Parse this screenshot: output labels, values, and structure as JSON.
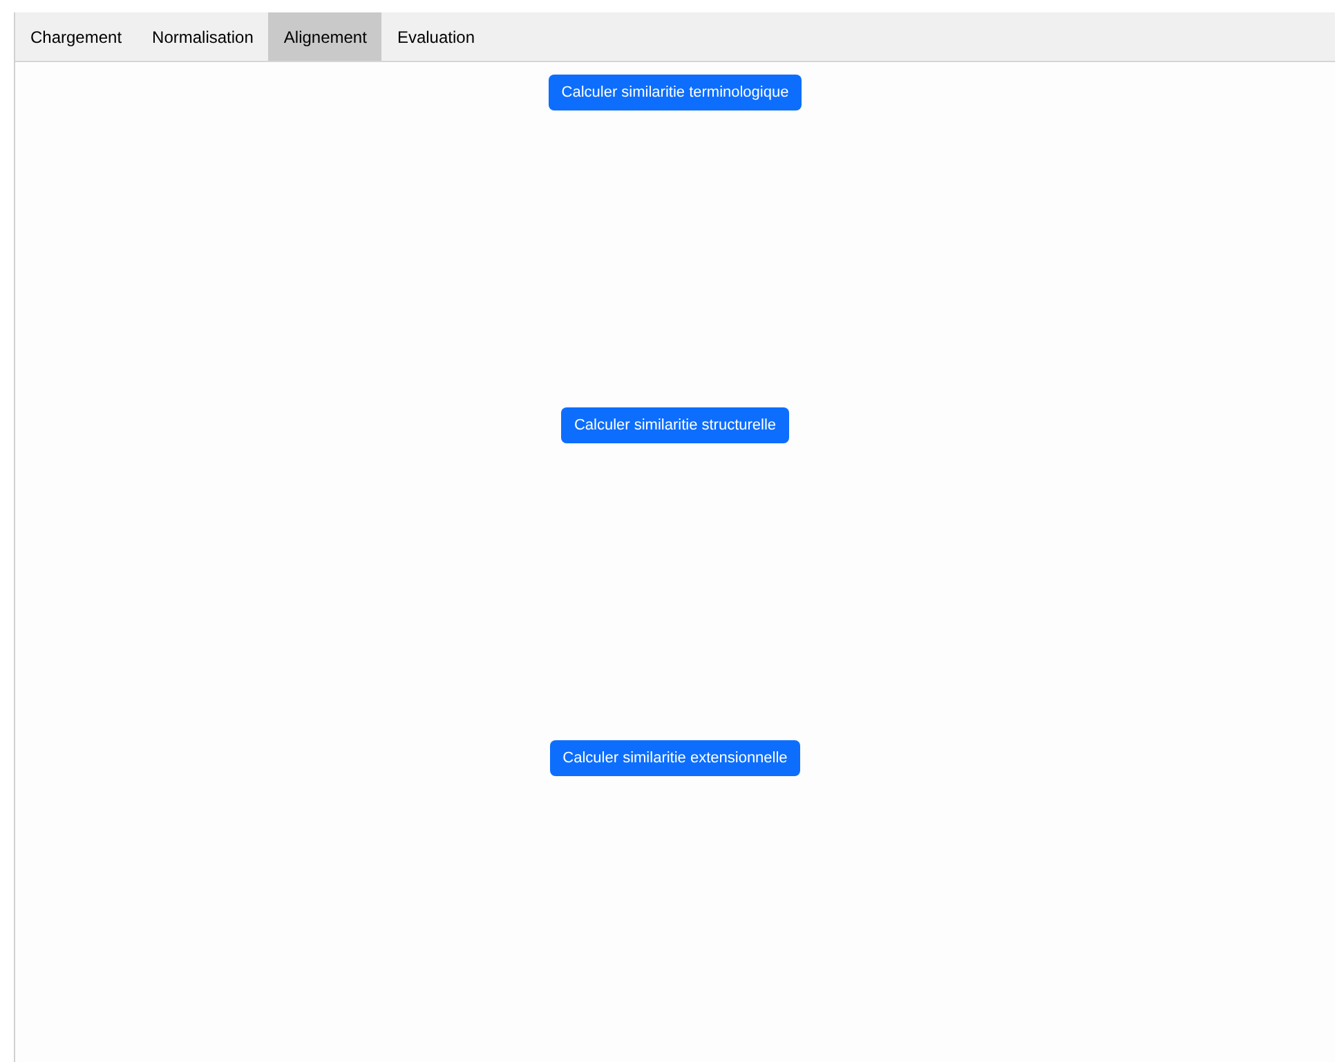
{
  "tabs": [
    {
      "label": "Chargement",
      "selected": false
    },
    {
      "label": "Normalisation",
      "selected": false
    },
    {
      "label": "Alignement",
      "selected": true
    },
    {
      "label": "Evaluation",
      "selected": false
    }
  ],
  "buttons": [
    "Calculer similaritie terminologique",
    "Calculer similaritie structurelle",
    "Calculer similaritie extensionnelle"
  ]
}
